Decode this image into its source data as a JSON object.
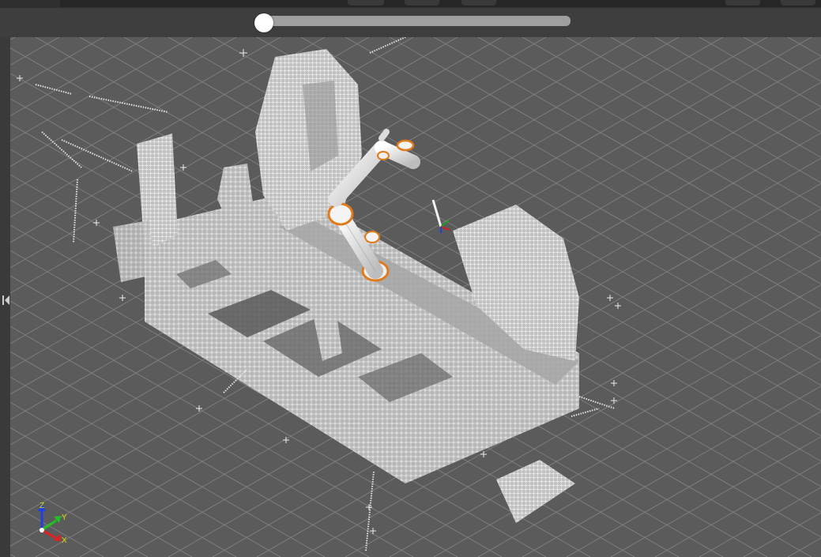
{
  "toolbar": {
    "buttons": [
      {
        "name": "toolbar-button-1"
      },
      {
        "name": "toolbar-button-2"
      },
      {
        "name": "toolbar-button-3"
      },
      {
        "name": "toolbar-button-4"
      },
      {
        "name": "toolbar-button-5"
      }
    ]
  },
  "timeline": {
    "position": 0.0
  },
  "sidebar": {
    "collapse_icon": "collapse-left-icon"
  },
  "scene": {
    "background_color": "#5b5b5b",
    "grid_color": "#8a8a8a",
    "point_cloud_color": "#e4e4e4",
    "robot_color": "#e8e8e8",
    "joint_accent_color": "#e07a1a"
  },
  "axes": {
    "z": "Z",
    "y": "Y",
    "x": "X",
    "z_color": "#2040e0",
    "y_color": "#20c020",
    "x_color": "#e02020"
  }
}
